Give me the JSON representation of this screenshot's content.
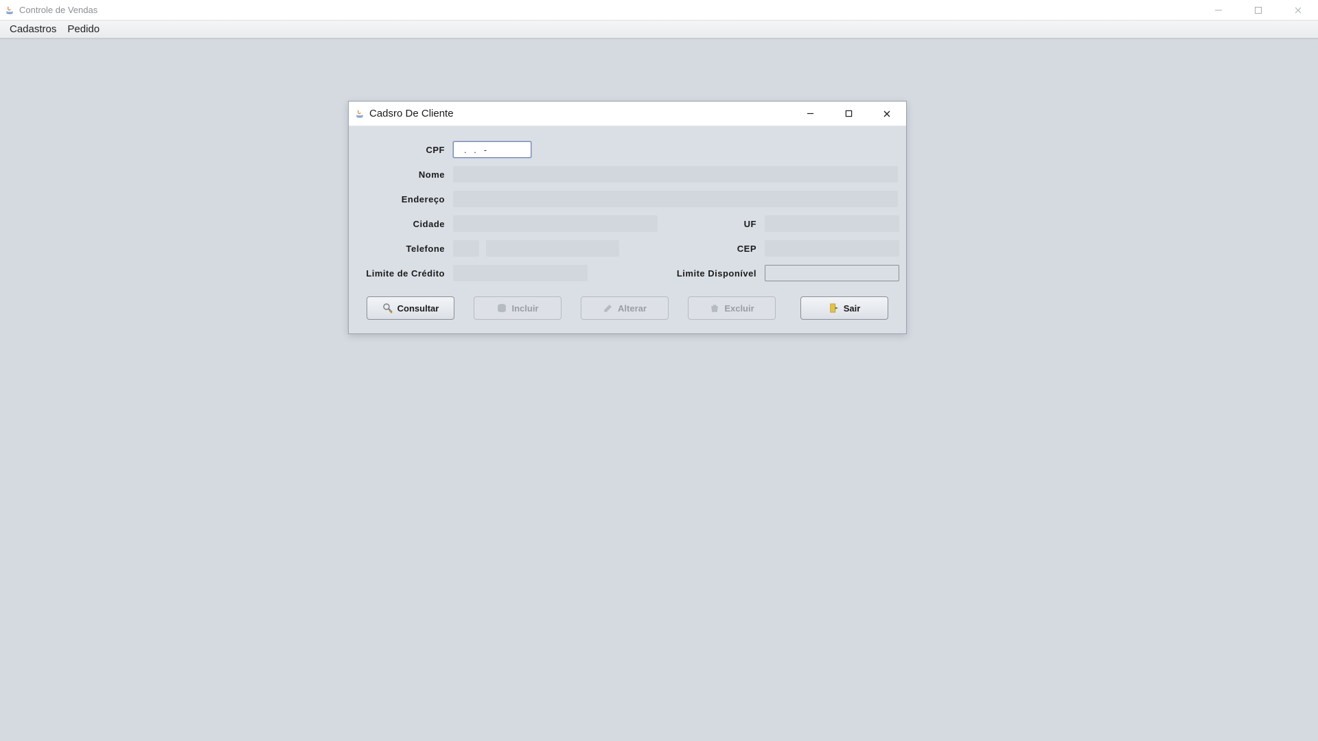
{
  "main_window": {
    "title": "Controle de Vendas"
  },
  "menubar": {
    "items": [
      "Cadastros",
      "Pedido"
    ]
  },
  "dialog": {
    "title": "Cadsro De Cliente",
    "labels": {
      "cpf": "CPF",
      "nome": "Nome",
      "endereco": "Endereço",
      "cidade": "Cidade",
      "uf": "UF",
      "telefone": "Telefone",
      "cep": "CEP",
      "limite_credito": "Limite de Crédito",
      "limite_disponivel": "Limite Disponível"
    },
    "fields": {
      "cpf": "   .   .   -",
      "nome": "",
      "endereco": "",
      "cidade": "",
      "uf": "",
      "ddd": "",
      "telefone": "",
      "cep": "",
      "limite_credito": "",
      "limite_disponivel": ""
    },
    "buttons": {
      "consultar": "Consultar",
      "incluir": "Incluir",
      "alterar": "Alterar",
      "excluir": "Excluir",
      "sair": "Sair"
    }
  }
}
